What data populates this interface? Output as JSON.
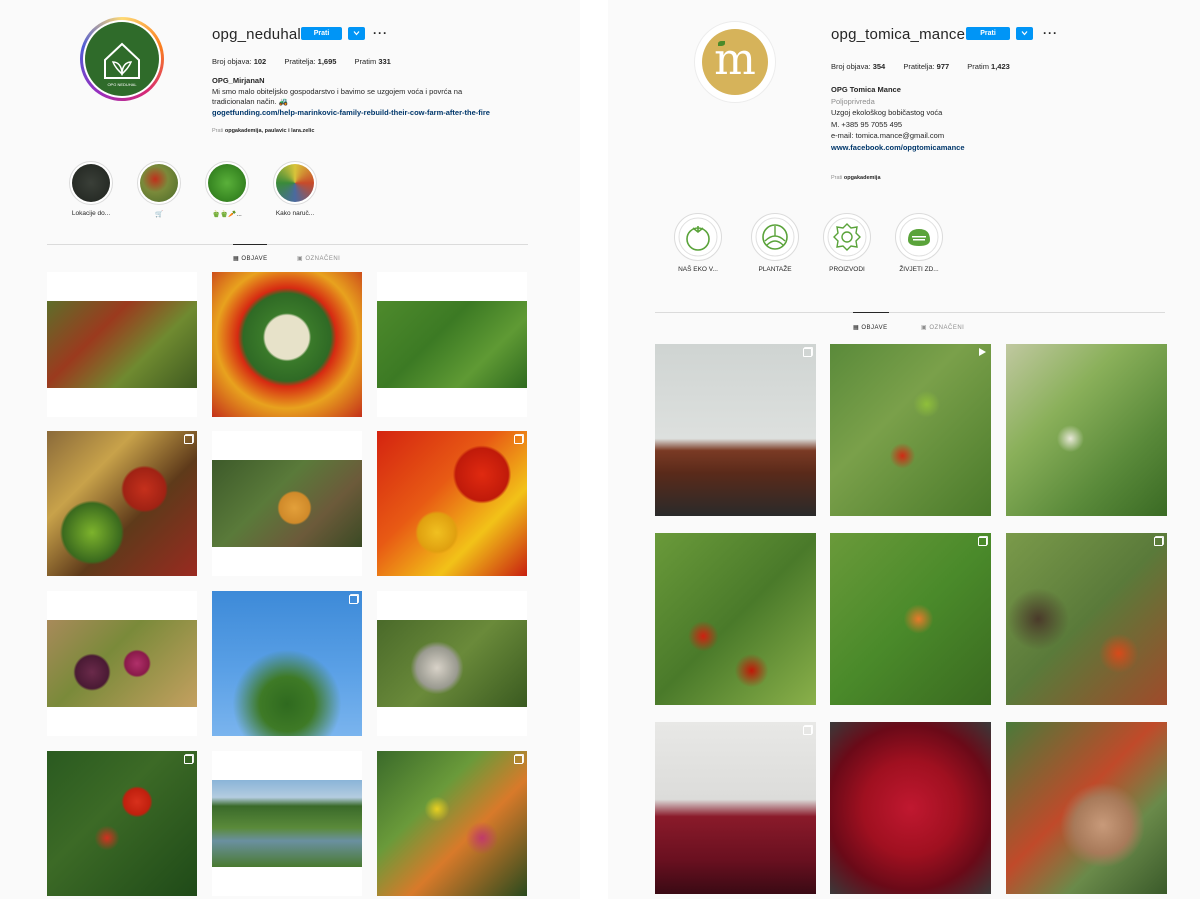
{
  "left_profile": {
    "username": "opg_neduhal",
    "follow_label": "Prati",
    "more_label": "···",
    "stats": {
      "posts_label": "Broj objava:",
      "posts": "102",
      "followers_label": "Pratitelja:",
      "followers": "1,695",
      "following_label": "Pratim",
      "following": "331"
    },
    "avatar_text": "OPG NEDUHAL",
    "bio": {
      "name": "OPG_MirjanaN",
      "line1": "Mi smo malo obiteljsko gospodarstvo i bavimo se uzgojem voća i povrća na",
      "line2": "tradicionalan način. 🚜",
      "link": "gogetfunding.com/help-marinkovic-family-rebuild-their-cow-farm-after-the-fire"
    },
    "followed_by": {
      "prefix": "Prati ",
      "names": "opgakademija, paulavic i lara.zelic"
    },
    "highlights": [
      {
        "label": "Lokacije do...",
        "color": "#2b2f2a"
      },
      {
        "label": "🛒",
        "color": "#6a8a3a"
      },
      {
        "label": "🫑🫑🥕...",
        "color": "#3f8f2a"
      },
      {
        "label": "Kako naruč...",
        "color": "#8a6a4a"
      }
    ],
    "tabs": {
      "posts": "OBJAVE",
      "tagged": "OZNAČENI"
    },
    "posts": [
      {
        "bg": "linear-gradient(135deg,#5d6e2a 0%,#9b3a1e 35%,#6f8a30 65%,#3f5a20 100%)",
        "multi": false,
        "frame": "wide"
      },
      {
        "bg": "radial-gradient(circle at 50% 45%,#e7e2c9 0%,#e7e2c9 20%,#3a7a2a 22%,#2f6a25 40%,#d62a12 45%,#e8a21e 65%,#c4301a 100%)",
        "multi": false,
        "frame": "full"
      },
      {
        "bg": "linear-gradient(135deg,#4e8a2c 0%,#3c7a24 40%,#5f9a34 70%,#2f6a1f 100%)",
        "multi": false,
        "frame": "wide"
      },
      {
        "bg": "radial-gradient(circle at 30% 70%,#7db32c 0%,#3a6a1e 20%,transparent 22%),radial-gradient(circle at 65% 40%,#c5301c 0%,#a02214 16%,transparent 18%),linear-gradient(135deg,#8a6a3a 0%,#c8a24a 30%,#5e3a1a 60%,#9a2a20 100%)",
        "multi": true,
        "frame": "full"
      },
      {
        "bg": "radial-gradient(circle at 55% 55%,#e3a03a 0%,#d08a2a 16%,transparent 18%),linear-gradient(135deg,#3d5a2a 0%,#5a7a3a 40%,#6c5a3a 70%,#3a4a24 100%)",
        "multi": false,
        "frame": "wide"
      },
      {
        "bg": "radial-gradient(circle at 40% 70%,#f0c020 0%,#e0a010 14%,transparent 16%),radial-gradient(circle at 70% 30%,#e02a10 0%,#c01a0a 18%,transparent 20%),linear-gradient(135deg,#d42410 0%,#e85a14 40%,#f2c218 70%,#c82010 100%)",
        "multi": true,
        "frame": "full"
      },
      {
        "bg": "radial-gradient(circle at 30% 60%,#6a2a4a 0%,#4a1a34 14%,transparent 16%),radial-gradient(circle at 60% 50%,#b0306a 0%,#8a1a4a 12%,transparent 14%),linear-gradient(135deg,#a88a5a 0%,#7a8a3a 40%,#c4a060 100%)",
        "multi": false,
        "frame": "wide"
      },
      {
        "bg": "radial-gradient(circle at 50% 78%,#2f6a1f 0%,#3e7a26 20%,transparent 40%),linear-gradient(180deg,#3d8ad8 0%,#5aa0e6 55%,#7ab4ee 100%)",
        "multi": true,
        "frame": "full"
      },
      {
        "bg": "radial-gradient(circle at 40% 55%,#d8d2c8 0%,#9a9a90 20%,transparent 26%),linear-gradient(135deg,#4a6a2a 0%,#6a8a3a 50%,#3a5a20 100%)",
        "multi": false,
        "frame": "wide"
      },
      {
        "bg": "radial-gradient(circle at 60% 35%,#d8301c 0%,#c0200e 10%,transparent 12%),radial-gradient(circle at 40% 60%,#d43020 0%,transparent 10%),linear-gradient(135deg,#2a5a20 0%,#3c6a26 40%,#1f4a18 100%)",
        "multi": true,
        "frame": "full"
      },
      {
        "bg": "linear-gradient(180deg,#8ab4d8 0%,#b4cce0 20%,#3a6a2a 30%,#5a8a3a 55%,#6a90a0 70%,#4a7a30 100%)",
        "multi": false,
        "frame": "wide"
      },
      {
        "bg": "radial-gradient(circle at 40% 40%,#e8d020 0%,transparent 10%),radial-gradient(circle at 70% 60%,#c03a6a 0%,transparent 12%),linear-gradient(135deg,#3a6a2a 0%,#6a9a3a 35%,#d87a2a 60%,#2a4a1e 100%)",
        "multi": true,
        "frame": "full"
      }
    ]
  },
  "right_profile": {
    "username": "opg_tomica_mance",
    "follow_label": "Prati",
    "more_label": "···",
    "stats": {
      "posts_label": "Broj objava:",
      "posts": "354",
      "followers_label": "Pratitelja:",
      "followers": "977",
      "following_label": "Pratim",
      "following": "1,423"
    },
    "avatar_letter": "m",
    "bio": {
      "name": "OPG Tomica Mance",
      "category": "Poljoprivreda",
      "line1": "Uzgoj ekološkog bobičastog voća",
      "phone": "M. +385 95 7055 495",
      "email": "e-mail: tomica.mance@gmail.com",
      "link": "www.facebook.com/opgtomicamance"
    },
    "followed_by": {
      "prefix": "Prati ",
      "names": "opgakademija"
    },
    "highlights": [
      {
        "label": "NAŠ EKO V...",
        "icon": "tomato-icon"
      },
      {
        "label": "PLANTAŽE",
        "icon": "field-icon"
      },
      {
        "label": "PROIZVODI",
        "icon": "gear-leaf-icon"
      },
      {
        "label": "ŽIVJETI ZD...",
        "icon": "badge-icon"
      }
    ],
    "tabs": {
      "posts": "OBJAVE",
      "tagged": "OZNAČENI"
    },
    "posts": [
      {
        "bg": "linear-gradient(180deg,#cfd4d2 0%,#dde0de 55%,#7a3a24 62%,#5a2a1a 75%,#2a2a2a 100%)",
        "badge": "multi"
      },
      {
        "bg": "radial-gradient(circle at 45% 65%,#d02a14 0%,transparent 9%),radial-gradient(circle at 60% 35%,#8fbf3a 0%,transparent 9%),linear-gradient(135deg,#5a8a3a 0%,#7aa04a 40%,#4a7a2a 100%)",
        "badge": "play"
      },
      {
        "bg": "radial-gradient(circle at 40% 55%,#e8e8d8 0%,transparent 10%),linear-gradient(135deg,#c0c8a0 0%,#8ab05a 35%,#5a8a3a 70%,#3a6a24 100%)",
        "badge": "none"
      },
      {
        "bg": "radial-gradient(circle at 30% 60%,#d02010 0%,transparent 10%),radial-gradient(circle at 60% 80%,#c01808 0%,transparent 10%),linear-gradient(135deg,#6a9a3a 0%,#4a7a2a 50%,#8ab04a 100%)",
        "badge": "none"
      },
      {
        "bg": "radial-gradient(circle at 55% 50%,#e87a2a 0%,transparent 12%),linear-gradient(135deg,#6a9a3a 0%,#4a8a2a 50%,#3a6a20 100%)",
        "badge": "multi"
      },
      {
        "bg": "radial-gradient(circle at 70% 70%,#d84a1a 0%,transparent 12%),radial-gradient(circle at 20% 50%,#4a3a2a 0%,transparent 20%),linear-gradient(135deg,#7a9a4a 0%,#5a7a3a 50%,#a04a2a 100%)",
        "badge": "multi"
      },
      {
        "bg": "linear-gradient(180deg,#e8e8e6 0%,#dcdcda 45%,#8a1a2a 55%,#6a1020 80%,#3a0a14 100%)",
        "badge": "multi"
      },
      {
        "bg": "radial-gradient(circle at 50% 50%,#c01830 0%,#a01020 40%,#6a0a18 70%,#3a3a3a 100%)",
        "badge": "none"
      },
      {
        "bg": "radial-gradient(circle at 60% 60%,#c89a7a 0%,#a87a5a 20%,transparent 30%),linear-gradient(135deg,#4a7a3a 0%,#c04a2a 45%,#6a8a4a 70%,#3a5a2a 100%)",
        "badge": "none"
      }
    ]
  }
}
